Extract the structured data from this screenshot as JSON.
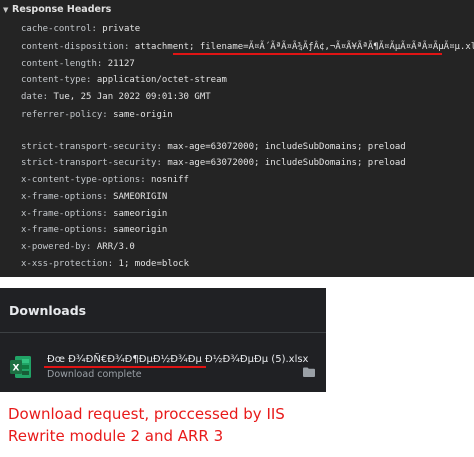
{
  "response_headers": {
    "title": "Response Headers",
    "rows": [
      {
        "name": "cache-control:",
        "value": "private"
      },
      {
        "name": "content-disposition:",
        "value": "attachment;",
        "value_highlight": "filename=Ã¤Ã´ÃªÃ¤Ã¾ÃƒÂ¢,¬Ã¤Ã¥ÃªÃ¶Ã¤ÃµÃ¤ÃªÃ¤ÃµÃ¤µ.xlsx"
      },
      {
        "name": "content-length:",
        "value": "21127"
      },
      {
        "name": "content-type:",
        "value": "application/octet-stream"
      },
      {
        "name": "date:",
        "value": "Tue, 25 Jan 2022 09:01:30 GMT"
      },
      {
        "name": "referrer-policy:",
        "value": "same-origin"
      },
      {
        "name": "strict-transport-security:",
        "value": "max-age=63072000; includeSubDomains; preload"
      },
      {
        "name": "strict-transport-security:",
        "value": "max-age=63072000; includeSubDomains; preload"
      },
      {
        "name": "x-content-type-options:",
        "value": "nosniff"
      },
      {
        "name": "x-frame-options:",
        "value": "SAMEORIGIN"
      },
      {
        "name": "x-frame-options:",
        "value": "sameorigin"
      },
      {
        "name": "x-frame-options:",
        "value": "sameorigin"
      },
      {
        "name": "x-powered-by:",
        "value": "ARR/3.0"
      },
      {
        "name": "x-xss-protection:",
        "value": "1; mode=block"
      }
    ]
  },
  "downloads": {
    "title": "Downloads",
    "item": {
      "filename": "Ðœ Ð¾ÐÑ€Ð¾Ð¶ÐµÐ½Ð¾Ðµ Ð½Ð¾ÐµÐµ (5).xlsx",
      "status": "Download complete",
      "icon": "excel-file-icon"
    }
  },
  "caption": {
    "line1": "Download request, proccessed by IIS",
    "line2": "Rewrite module 2 and ARR 3"
  },
  "colors": {
    "accent_red": "#e01414",
    "headers_bg": "#242424",
    "downloads_bg": "#202124",
    "excel_green": "#1d6f42"
  }
}
